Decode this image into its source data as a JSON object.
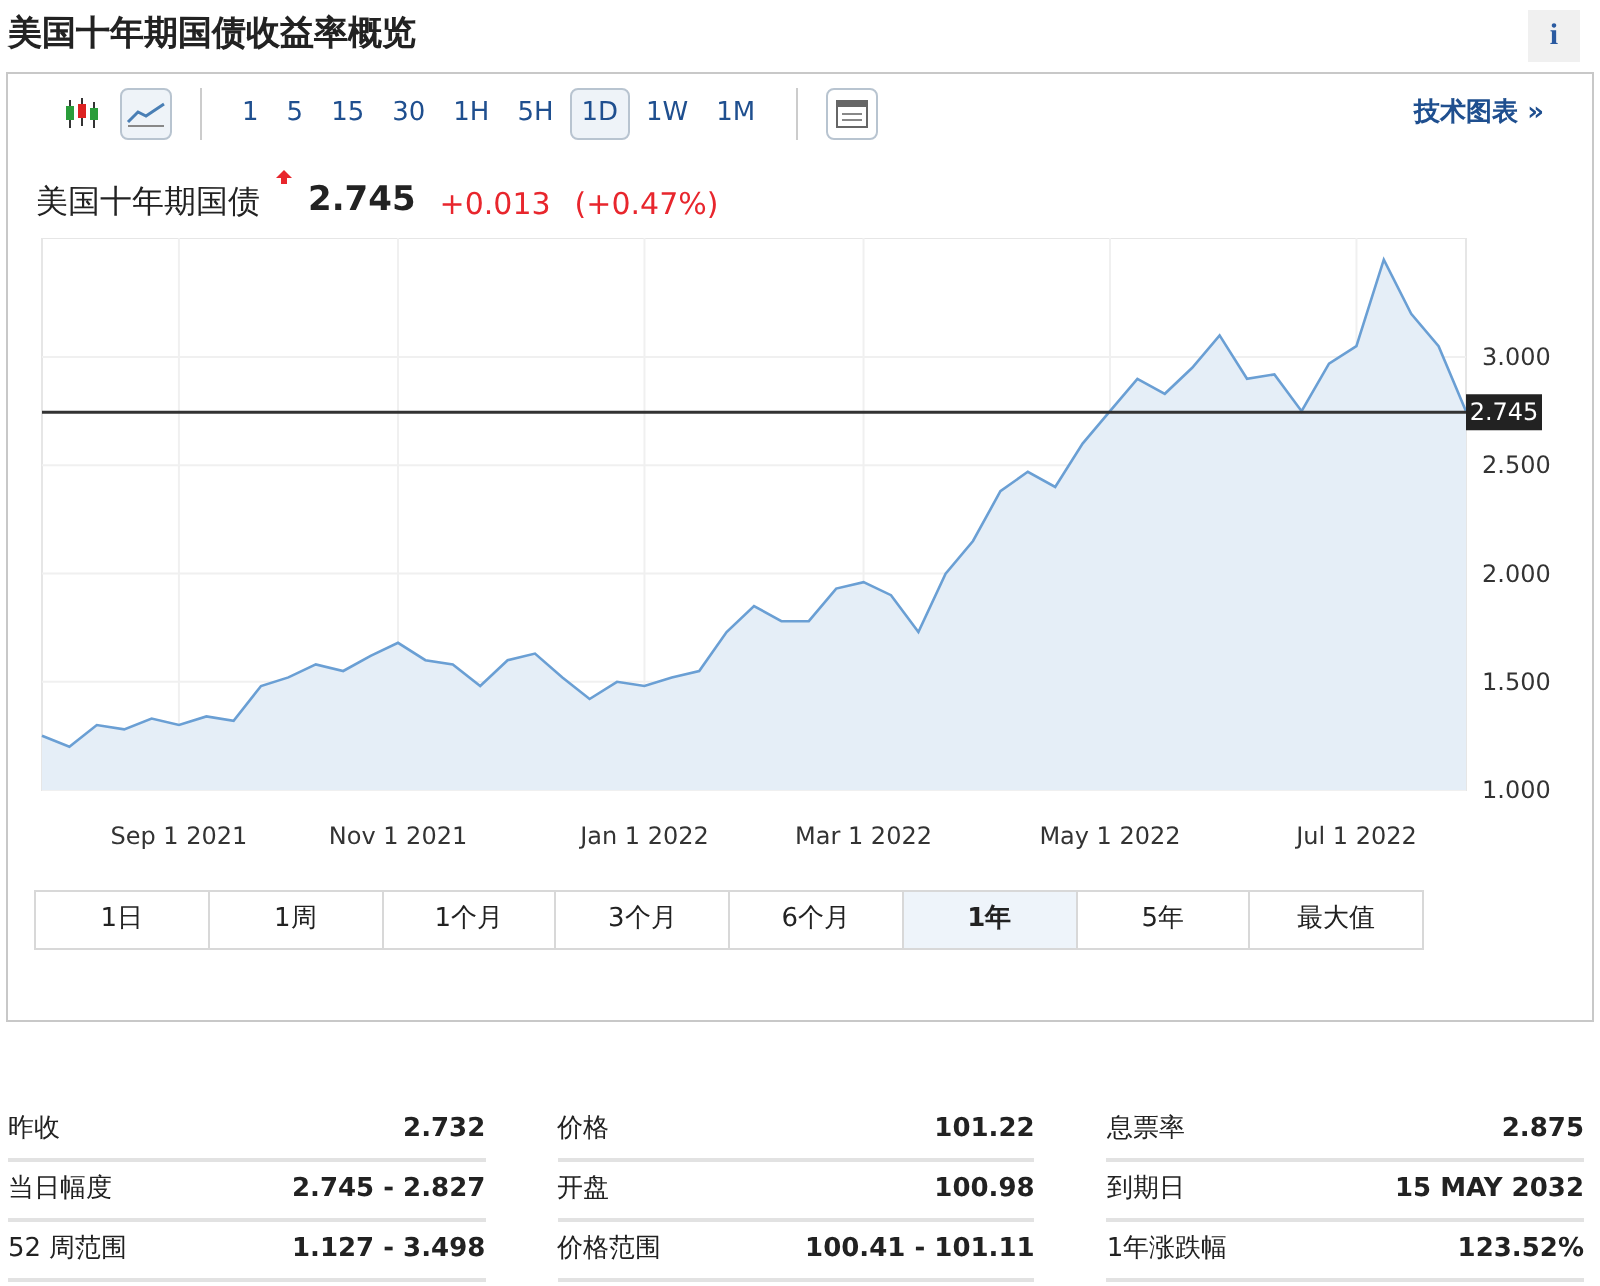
{
  "title": "美国十年期国债收益率概览",
  "info_button": "i",
  "toolbar": {
    "chart_types": [
      {
        "kind": "candlestick",
        "selected": false
      },
      {
        "kind": "line",
        "selected": true
      }
    ],
    "intervals": [
      {
        "label": "1",
        "selected": false
      },
      {
        "label": "5",
        "selected": false
      },
      {
        "label": "15",
        "selected": false
      },
      {
        "label": "30",
        "selected": false
      },
      {
        "label": "1H",
        "selected": false
      },
      {
        "label": "5H",
        "selected": false
      },
      {
        "label": "1D",
        "selected": true
      },
      {
        "label": "1W",
        "selected": false
      },
      {
        "label": "1M",
        "selected": false
      }
    ],
    "technical_link": "技术图表 »"
  },
  "quote": {
    "name": "美国十年期国债",
    "price": "2.745",
    "change": "+0.013",
    "change_percent": "(+0.47%)"
  },
  "chart": {
    "chart_data": {
      "type": "area",
      "grid": true,
      "ref_lines": [
        {
          "axis": "y",
          "value": 2.745,
          "label": "2.745"
        }
      ],
      "categories": [
        null,
        null,
        null,
        null,
        null,
        "Sep 1 2021",
        null,
        null,
        null,
        null,
        null,
        null,
        null,
        "Nov 1 2021",
        null,
        null,
        null,
        null,
        null,
        null,
        null,
        null,
        "Jan 1 2022",
        null,
        null,
        null,
        null,
        null,
        null,
        null,
        "Mar 1 2022",
        null,
        null,
        null,
        null,
        null,
        null,
        null,
        null,
        "May 1 2022",
        null,
        null,
        null,
        null,
        null,
        null,
        null,
        null,
        "Jul 1 2022",
        null,
        null,
        null,
        null
      ],
      "series": [
        {
          "color": "#6a9fd4",
          "values": [
            1.25,
            1.2,
            1.3,
            1.28,
            1.33,
            1.3,
            1.34,
            1.32,
            1.48,
            1.52,
            1.58,
            1.55,
            1.62,
            1.68,
            1.6,
            1.58,
            1.48,
            1.6,
            1.63,
            1.52,
            1.42,
            1.5,
            1.48,
            1.52,
            1.55,
            1.73,
            1.85,
            1.78,
            1.78,
            1.93,
            1.96,
            1.9,
            1.73,
            2.0,
            2.15,
            2.38,
            2.47,
            2.4,
            2.6,
            2.75,
            2.9,
            2.83,
            2.95,
            3.1,
            2.9,
            2.92,
            2.75,
            2.97,
            3.05,
            3.45,
            3.2,
            3.05,
            2.75
          ]
        }
      ],
      "ylim": [
        1.0,
        3.55
      ],
      "yticks": [
        {
          "value": 1.0,
          "label": "1.000"
        },
        {
          "value": 1.5,
          "label": "1.500"
        },
        {
          "value": 2.0,
          "label": "2.000"
        },
        {
          "value": 2.5,
          "label": "2.500"
        },
        {
          "value": 3.0,
          "label": "3.000"
        }
      ]
    }
  },
  "ranges": [
    {
      "label": "1日",
      "selected": false
    },
    {
      "label": "1周",
      "selected": false
    },
    {
      "label": "1个月",
      "selected": false
    },
    {
      "label": "3个月",
      "selected": false
    },
    {
      "label": "6个月",
      "selected": false
    },
    {
      "label": "1年",
      "selected": true
    },
    {
      "label": "5年",
      "selected": false
    },
    {
      "label": "最大值",
      "selected": false
    }
  ],
  "stats": [
    [
      {
        "label": "昨收",
        "value": "2.732"
      },
      {
        "label": "当日幅度",
        "value": "2.745 - 2.827"
      },
      {
        "label": "52 周范围",
        "value": "1.127 - 3.498"
      }
    ],
    [
      {
        "label": "价格",
        "value": "101.22"
      },
      {
        "label": "开盘",
        "value": "100.98"
      },
      {
        "label": "价格范围",
        "value": "100.41 - 101.11"
      }
    ],
    [
      {
        "label": "息票率",
        "value": "2.875"
      },
      {
        "label": "到期日",
        "value": "15 MAY 2032"
      },
      {
        "label": "1年涨跌幅",
        "value": "123.52%"
      }
    ]
  ]
}
